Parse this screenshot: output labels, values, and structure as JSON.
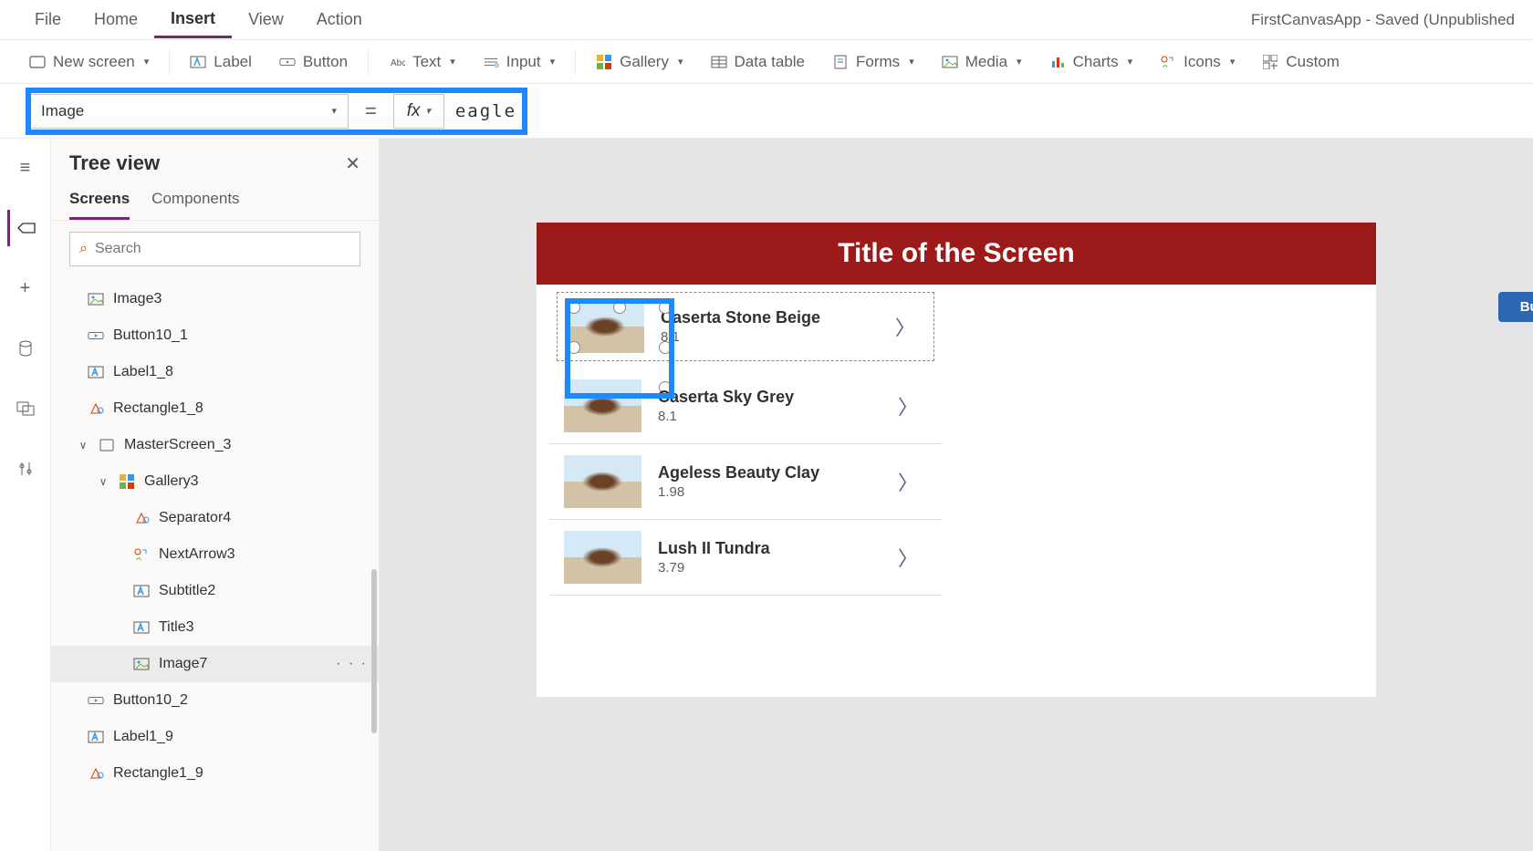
{
  "app_title": "FirstCanvasApp - Saved (Unpublished",
  "menubar": [
    "File",
    "Home",
    "Insert",
    "View",
    "Action"
  ],
  "menubar_active_index": 2,
  "ribbon": {
    "new_screen": "New screen",
    "label": "Label",
    "button": "Button",
    "text": "Text",
    "input": "Input",
    "gallery": "Gallery",
    "data_table": "Data table",
    "forms": "Forms",
    "media": "Media",
    "charts": "Charts",
    "icons": "Icons",
    "custom": "Custom"
  },
  "formula": {
    "property": "Image",
    "equals": "=",
    "fx": "fx",
    "value": "eagle"
  },
  "panel": {
    "title": "Tree view",
    "tabs": [
      "Screens",
      "Components"
    ],
    "active_tab": 0,
    "search_placeholder": "Search"
  },
  "tree": [
    {
      "label": "Image3",
      "icon": "image",
      "indent": 1
    },
    {
      "label": "Button10_1",
      "icon": "button",
      "indent": 1
    },
    {
      "label": "Label1_8",
      "icon": "label",
      "indent": 1
    },
    {
      "label": "Rectangle1_8",
      "icon": "rect",
      "indent": 1
    },
    {
      "label": "MasterScreen_3",
      "icon": "screen",
      "indent": 2,
      "expander": "∨"
    },
    {
      "label": "Gallery3",
      "icon": "gallery",
      "indent": 3,
      "expander": "∨"
    },
    {
      "label": "Separator4",
      "icon": "separator",
      "indent": 4
    },
    {
      "label": "NextArrow3",
      "icon": "icons",
      "indent": 4
    },
    {
      "label": "Subtitle2",
      "icon": "label",
      "indent": 4
    },
    {
      "label": "Title3",
      "icon": "label",
      "indent": 4
    },
    {
      "label": "Image7",
      "icon": "image",
      "indent": 4,
      "selected": true,
      "dots": "· · ·"
    },
    {
      "label": "Button10_2",
      "icon": "button",
      "indent": 1
    },
    {
      "label": "Label1_9",
      "icon": "label",
      "indent": 1
    },
    {
      "label": "Rectangle1_9",
      "icon": "rect",
      "indent": 1
    }
  ],
  "canvas": {
    "title": "Title of the Screen",
    "button_label": "Button",
    "rows": [
      {
        "title": "Caserta Stone Beige",
        "subtitle": "8.1"
      },
      {
        "title": "Caserta Sky Grey",
        "subtitle": "8.1"
      },
      {
        "title": "Ageless Beauty Clay",
        "subtitle": "1.98"
      },
      {
        "title": "Lush II Tundra",
        "subtitle": "3.79"
      }
    ]
  }
}
